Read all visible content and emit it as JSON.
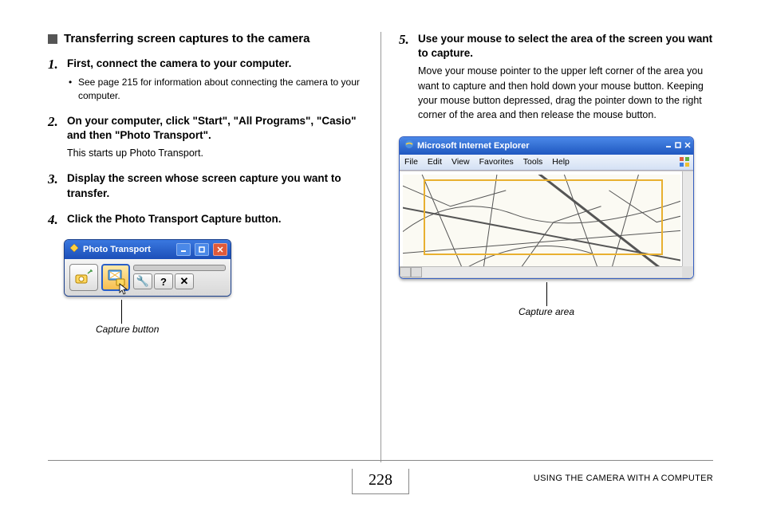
{
  "section_title": "Transferring screen captures to the camera",
  "steps": {
    "s1": {
      "num": "1.",
      "title": "First, connect the camera to your computer.",
      "bullet": "See page 215 for information about connecting the camera to your computer."
    },
    "s2": {
      "num": "2.",
      "title": "On your computer, click \"Start\", \"All Programs\", \"Casio\" and then \"Photo Transport\".",
      "desc": "This starts up Photo Transport."
    },
    "s3": {
      "num": "3.",
      "title": "Display the screen whose screen capture you want to transfer."
    },
    "s4": {
      "num": "4.",
      "title": "Click the Photo Transport Capture button."
    },
    "s5": {
      "num": "5.",
      "title": "Use your mouse to select the area of the screen you want to capture.",
      "desc": "Move your mouse pointer to the upper left corner of the area you want to capture and then hold down your mouse button. Keeping your mouse button depressed, drag the pointer down to the right corner of the area and then release the mouse button."
    }
  },
  "pt_window": {
    "title": "Photo Transport",
    "tool_wrench": "🔧",
    "tool_help": "?",
    "tool_close": "✕"
  },
  "callouts": {
    "capture_button": "Capture button",
    "capture_area": "Capture area"
  },
  "ie_window": {
    "title": "Microsoft Internet Explorer",
    "menu": {
      "file": "File",
      "edit": "Edit",
      "view": "View",
      "favorites": "Favorites",
      "tools": "Tools",
      "help": "Help"
    }
  },
  "footer": {
    "page": "228",
    "section": "USING THE CAMERA WITH A COMPUTER"
  }
}
